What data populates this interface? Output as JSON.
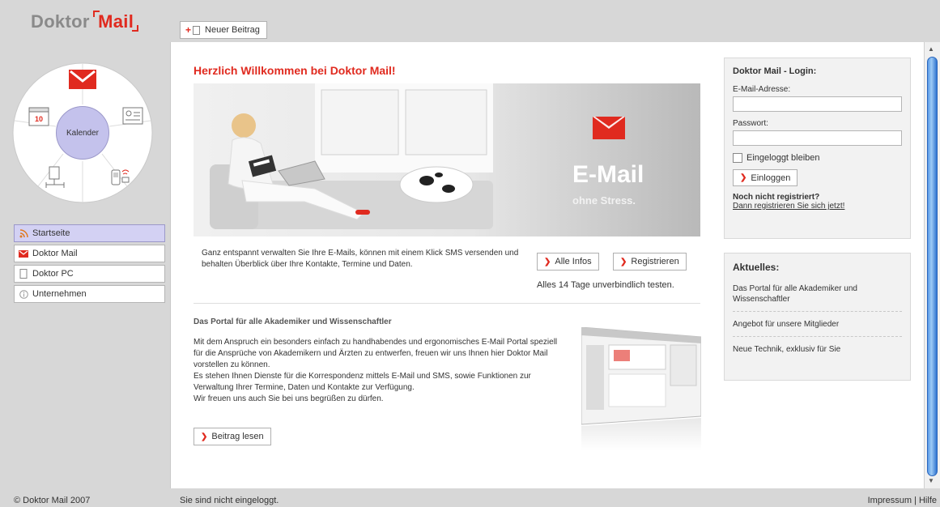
{
  "sidebar": {
    "logo_part1": "Doktor",
    "logo_part2": "Mail",
    "wheel_center_label": "Kalender",
    "calendar_day": "10",
    "nav": [
      {
        "label": "Startseite",
        "icon": "rss-icon"
      },
      {
        "label": "Doktor Mail",
        "icon": "envelope-icon"
      },
      {
        "label": "Doktor PC",
        "icon": "document-icon"
      },
      {
        "label": "Unternehmen",
        "icon": "info-icon"
      }
    ],
    "copyright": "© Doktor Mail 2007"
  },
  "toolbar": {
    "new_post_label": "Neuer Beitrag"
  },
  "main": {
    "welcome_title": "Herzlich Willkommen bei Doktor Mail!",
    "hero": {
      "headline": "E-Mail",
      "tagline": "ohne Stress."
    },
    "intro_text": "Ganz entspannt verwalten Sie Ihre E-Mails, können mit einem Klick SMS versenden und behalten Überblick über Ihre Kontakte, Termine und Daten.",
    "all_infos_label": "Alle Infos",
    "register_label": "Registrieren",
    "trial_text": "Alles 14 Tage unverbindlich testen.",
    "portal_title": "Das Portal für alle Akademiker und Wissenschaftler",
    "portal_body_1": "Mit dem Anspruch ein besonders einfach zu handhabendes und ergonomisches E-Mail Portal speziell für die Ansprüche von Akademikern und Ärzten zu entwerfen, freuen wir uns Ihnen hier Doktor Mail vorstellen zu können.",
    "portal_body_2": "Es stehen Ihnen Dienste für die Korrespondenz mittels E-Mail und SMS, sowie Funktionen zur Verwaltung Ihrer Termine, Daten und Kontakte zur Verfügung.",
    "portal_body_3": "Wir freuen uns auch Sie bei uns begrüßen zu dürfen.",
    "read_post_label": "Beitrag lesen"
  },
  "login": {
    "title": "Doktor Mail - Login:",
    "email_label": "E-Mail-Adresse:",
    "email_value": "",
    "password_label": "Passwort:",
    "password_value": "",
    "stay_logged_in_label": "Eingeloggt bleiben",
    "login_button_label": "Einloggen",
    "not_registered": "Noch nicht registriert?",
    "register_link": "Dann registrieren Sie sich jetzt!"
  },
  "news": {
    "title": "Aktuelles:",
    "items": [
      "Das Portal für alle Akademiker und Wissenschaftler",
      "Angebot für unsere Mitglieder",
      "Neue Technik, exklusiv für Sie"
    ]
  },
  "footer": {
    "status": "Sie sind nicht eingeloggt.",
    "imprint": "Impressum",
    "separator": "|",
    "help": "Hilfe"
  },
  "colors": {
    "brand_red": "#e02a1f",
    "nav_active": "#d3d1f3",
    "scroll_blue": "#2f73cf"
  }
}
